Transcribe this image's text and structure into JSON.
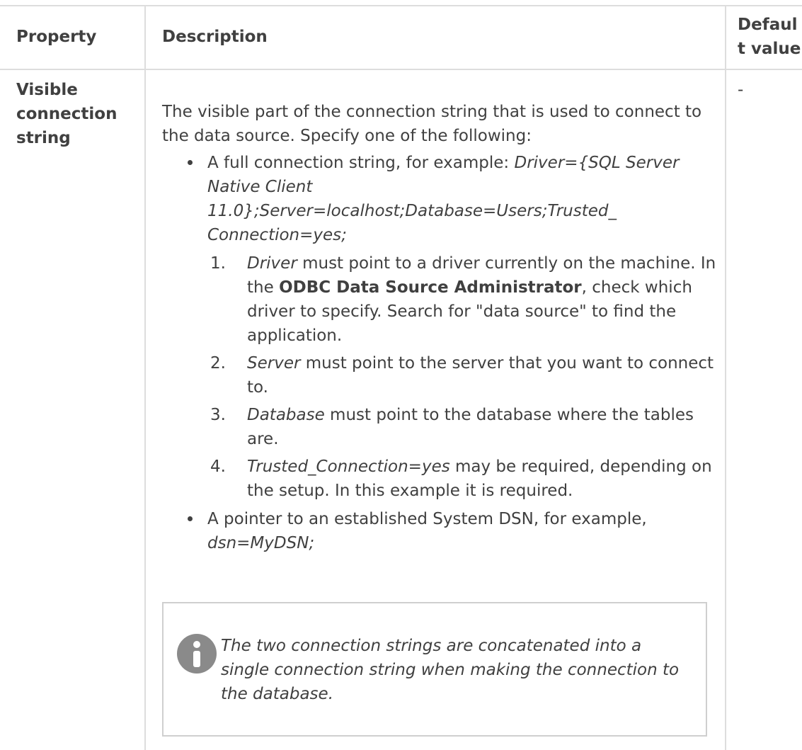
{
  "table": {
    "headers": {
      "property": "Property",
      "description": "Description",
      "default_line1": "Defaul",
      "default_line2": "t value"
    },
    "row": {
      "property_line1": "Visible",
      "property_line2": "connection",
      "property_line3": "string",
      "description_intro": "The visible part of the connection string that is used to connect to the data source. Specify one of the following:",
      "default_value": "-",
      "bullets": [
        {
          "text": "A full connection string, for example: ",
          "example": "Driver={SQL Server Native Client 11.0};Server=localhost;Database=Users;Trusted_ Connection=yes;"
        },
        {
          "text": "A pointer to an established System DSN, for example, ",
          "example": "dsn=MyDSN;"
        }
      ],
      "numbered": [
        {
          "number": "1.",
          "term": "Driver",
          "text_before": " must point to a driver currently on the machine. In the ",
          "bold": "ODBC Data Source Administrator",
          "text_after": ", check which driver to specify. Search for \"data source\" to find the application."
        },
        {
          "number": "2.",
          "term": "Server",
          "text": " must point to the server that you want to connect to."
        },
        {
          "number": "3.",
          "term": "Database",
          "text": " must point to the database where the tables are."
        },
        {
          "number": "4.",
          "term": "Trusted_Connection=yes",
          "text": " may be required, depending on the setup. In this example it is required."
        }
      ],
      "note": {
        "icon": "info-icon",
        "text": "The two connection strings are concatenated into a single connection string when making the connection to the database."
      }
    }
  }
}
